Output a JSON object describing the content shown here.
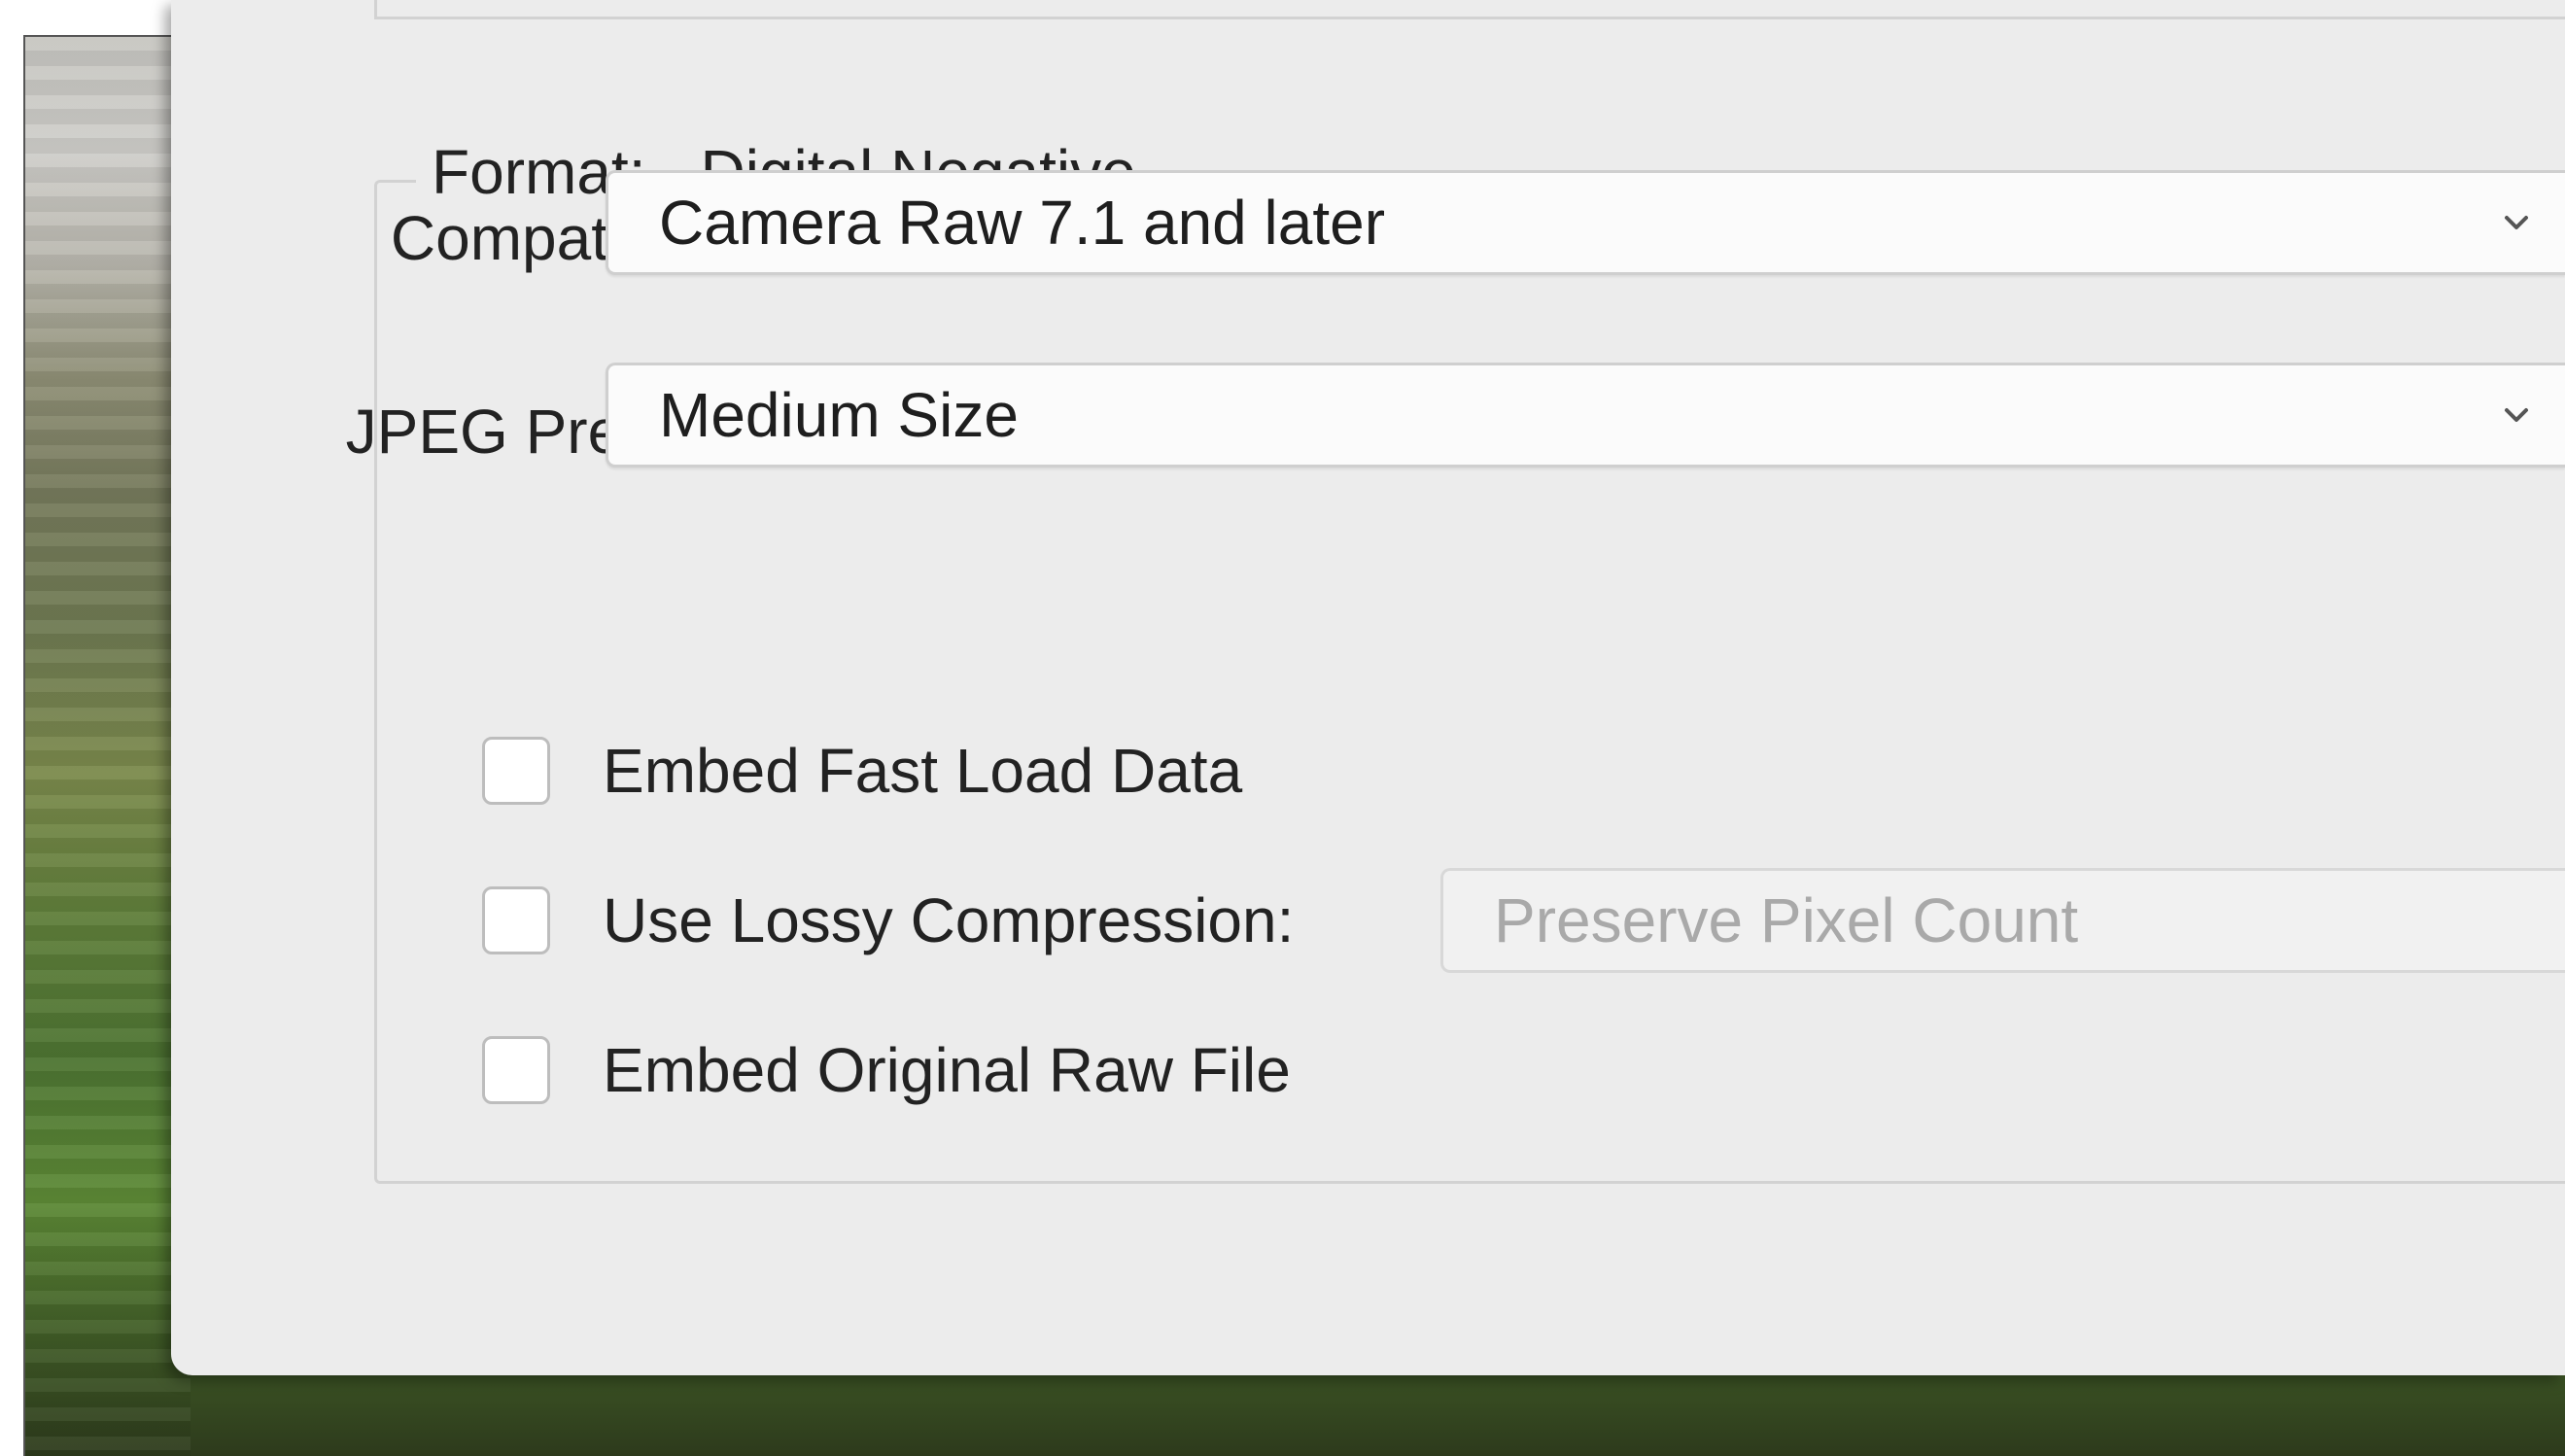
{
  "format_group": {
    "label": "Format:",
    "value": "Digital Negative"
  },
  "compatibility": {
    "label": "Compatibility:",
    "selected": "Camera Raw 7.1 and later"
  },
  "jpeg_preview": {
    "label": "JPEG Preview:",
    "selected": "Medium Size"
  },
  "options": {
    "embed_fast_load": {
      "label": "Embed Fast Load Data",
      "checked": false
    },
    "lossy_compression": {
      "label": "Use Lossy Compression:",
      "checked": false,
      "selected": "Preserve Pixel Count",
      "enabled": false
    },
    "embed_original_raw": {
      "label": "Embed Original Raw File",
      "checked": false
    }
  },
  "icons": {
    "dropdown": "chevron-down-icon"
  }
}
